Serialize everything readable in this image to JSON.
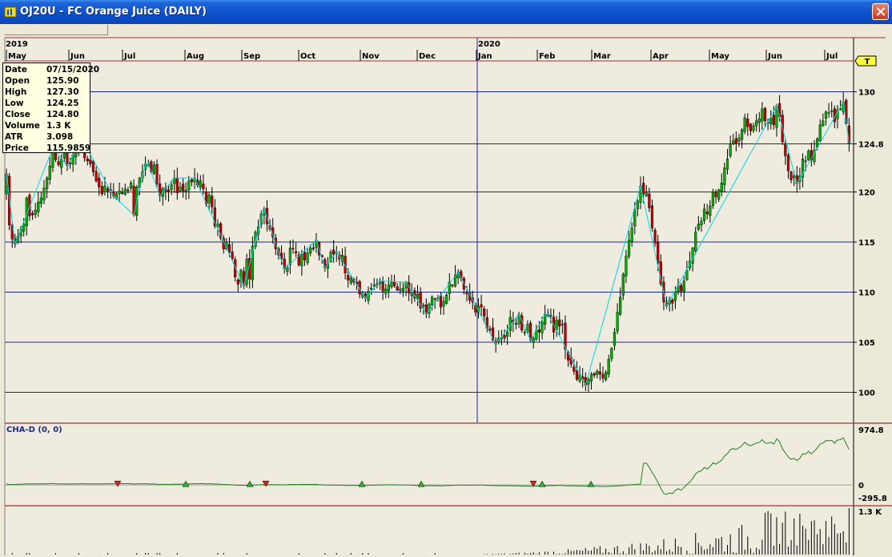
{
  "window": {
    "title": "OJ20U - FC Orange Juice (DAILY)"
  },
  "info": [
    {
      "k": "Date",
      "v": "07/15/2020"
    },
    {
      "k": "Open",
      "v": "125.90"
    },
    {
      "k": "High",
      "v": "127.30"
    },
    {
      "k": "Low",
      "v": "124.25"
    },
    {
      "k": "Close",
      "v": "124.80"
    },
    {
      "k": "Volume",
      "v": "1.3 K"
    },
    {
      "k": "ATR",
      "v": "3.098"
    },
    {
      "k": "Price",
      "v": "115.9859"
    }
  ],
  "years": [
    "2019",
    "2020"
  ],
  "months": [
    "May",
    "Jun",
    "Jul",
    "Aug",
    "Sep",
    "Oct",
    "Nov",
    "Dec",
    "Jan",
    "Feb",
    "Mar",
    "Apr",
    "May",
    "Jun",
    "Jul"
  ],
  "price_axis": {
    "labels": [
      "130",
      "124.8",
      "120",
      "115",
      "110",
      "105",
      "100"
    ],
    "current_marker": "T"
  },
  "indicator": {
    "title": "CHA-D (0, 0)",
    "top_label": "974.8",
    "zero_label": "0",
    "bottom_label": "-295.8"
  },
  "volume": {
    "top_label": "1.3 K"
  },
  "colors": {
    "up": "#00b000",
    "down": "#c00000",
    "swing": "#00d8e0",
    "grid": "#1c2a8a",
    "separator": "#a03030",
    "pane_bg": "#efebde"
  },
  "chart_data": {
    "type": "ohlc",
    "symbol": "OJ20U",
    "ylim": [
      97,
      133
    ],
    "y_ticks": [
      130,
      124.8,
      120,
      115,
      110,
      105,
      100
    ],
    "closes": [
      121.8,
      116.7,
      115.3,
      114.8,
      115.6,
      116.3,
      116.8,
      119.4,
      117.6,
      117.7,
      118.2,
      119.0,
      119.4,
      120.4,
      121.4,
      122.6,
      124.4,
      123.2,
      122.7,
      123.3,
      124.1,
      122.6,
      122.9,
      123.7,
      124.3,
      124.8,
      125.3,
      123.4,
      123.1,
      122.8,
      122.0,
      121.1,
      120.5,
      119.8,
      120.6,
      120.1,
      120.2,
      119.6,
      119.8,
      120.1,
      119.9,
      120.3,
      120.2,
      120.9,
      117.7,
      120.5,
      121.4,
      122.0,
      122.8,
      122.8,
      122.0,
      122.7,
      120.8,
      119.6,
      120.3,
      120.1,
      120.0,
      120.7,
      121.4,
      119.9,
      120.5,
      120.1,
      120.2,
      121.1,
      121.0,
      121.4,
      120.7,
      121.1,
      120.3,
      118.8,
      119.7,
      118.5,
      116.6,
      116.8,
      115.4,
      114.3,
      115.0,
      114.0,
      113.3,
      111.5,
      110.8,
      112.2,
      110.6,
      113.3,
      111.3,
      114.6,
      116.0,
      116.5,
      117.8,
      118.3,
      116.8,
      116.3,
      115.5,
      114.3,
      113.7,
      113.3,
      112.3,
      112.5,
      114.4,
      114.3,
      113.9,
      112.7,
      113.8,
      113.2,
      113.9,
      114.4,
      114.4,
      115.2,
      113.7,
      113.5,
      112.4,
      112.8,
      114.0,
      113.8,
      114.0,
      113.3,
      113.7,
      111.9,
      111.2,
      111.4,
      111.0,
      110.8,
      109.8,
      109.9,
      109.4,
      110.1,
      110.4,
      110.7,
      110.7,
      111.1,
      110.1,
      110.3,
      110.7,
      111.0,
      110.6,
      110.2,
      110.3,
      110.4,
      111.0,
      109.9,
      109.9,
      109.4,
      109.8,
      108.4,
      108.7,
      107.8,
      108.8,
      109.5,
      109.3,
      109.4,
      108.5,
      109.1,
      109.7,
      111.0,
      110.7,
      111.7,
      112.0,
      111.4,
      110.3,
      109.8,
      109.2,
      109.0,
      108.0,
      108.6,
      108.5,
      107.6,
      106.4,
      106.2,
      105.2,
      104.8,
      105.4,
      105.5,
      105.4,
      106.0,
      107.5,
      107.0,
      106.9,
      107.8,
      106.2,
      106.0,
      106.8,
      105.2,
      105.4,
      106.2,
      106.0,
      107.0,
      107.8,
      107.8,
      107.7,
      106.0,
      107.2,
      106.6,
      106.8,
      104.3,
      103.2,
      102.8,
      102.1,
      101.3,
      101.8,
      101.3,
      100.7,
      101.3,
      101.8,
      101.7,
      102.1,
      101.8,
      101.4,
      102.0,
      103.3,
      104.4,
      106.0,
      108.0,
      109.5,
      111.8,
      113.6,
      115.2,
      116.4,
      118.2,
      119.1,
      120.6,
      119.8,
      119.9,
      118.4,
      116.4,
      114.9,
      112.9,
      110.8,
      109.0,
      108.6,
      109.2,
      108.9,
      110.1,
      110.7,
      110.1,
      111.1,
      112.2,
      113.1,
      114.4,
      116.0,
      116.8,
      117.1,
      118.3,
      117.8,
      118.6,
      120.0,
      119.5,
      120.2,
      120.9,
      122.4,
      123.3,
      124.7,
      125.1,
      124.8,
      125.4,
      126.2,
      127.4,
      126.5,
      126.1,
      126.6,
      127.1,
      127.3,
      128.3,
      127.1,
      127.0,
      127.4,
      126.7,
      128.6,
      127.5,
      125.0,
      123.6,
      122.1,
      121.2,
      121.6,
      120.8,
      121.6,
      123.3,
      123.1,
      124.1,
      123.2,
      124.2,
      125.3,
      126.7,
      127.1,
      128.0,
      127.9,
      128.1,
      127.0,
      128.2,
      128.3,
      129.0,
      126.8,
      124.8
    ],
    "indicator_range": [
      -295.8,
      974.8
    ],
    "volume_max_label": "1.3 K"
  }
}
